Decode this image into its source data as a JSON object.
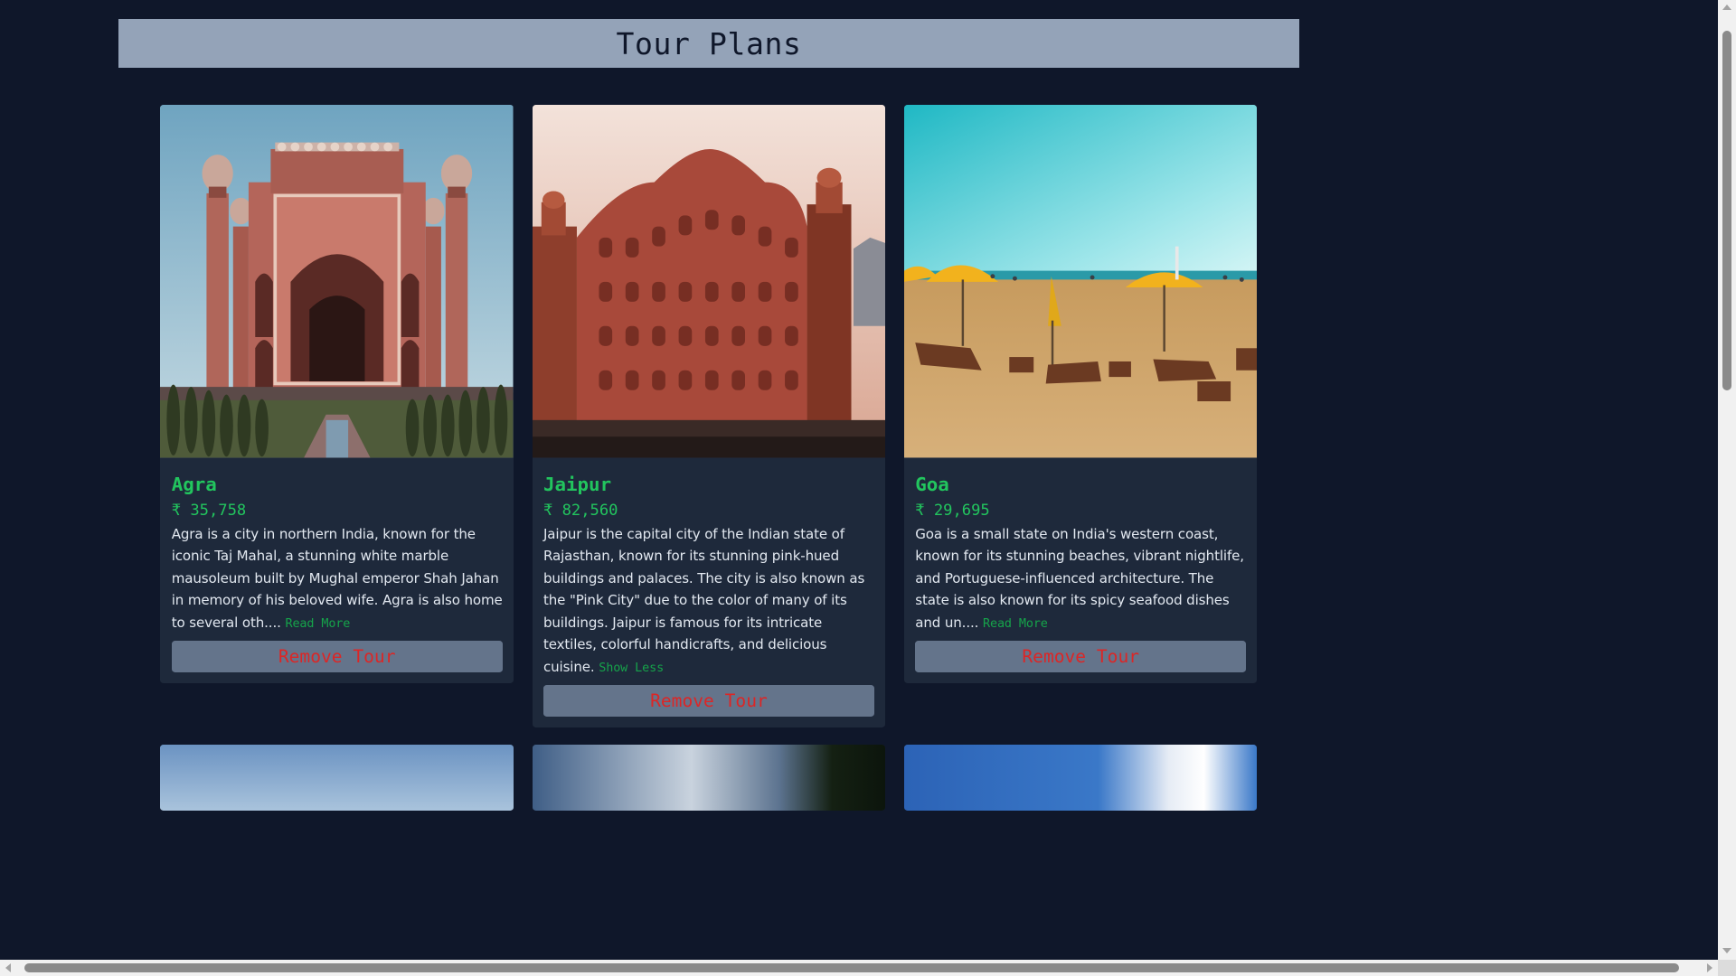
{
  "header": {
    "title": "Tour Plans"
  },
  "tours": [
    {
      "name": "Agra",
      "price": "₹ 35,758",
      "description": "Agra is a city in northern India, known for the iconic Taj Mahal, a stunning white marble mausoleum built by Mughal emperor Shah Jahan in memory of his beloved wife. Agra is also home to several oth....",
      "toggle_label": "Read More",
      "remove_label": "Remove Tour"
    },
    {
      "name": "Jaipur",
      "price": "₹ 82,560",
      "description": "Jaipur is the capital city of the Indian state of Rajasthan, known for its stunning pink-hued buildings and palaces. The city is also known as the \"Pink City\" due to the color of many of its buildings. Jaipur is famous for its intricate textiles, colorful handicrafts, and delicious cuisine.",
      "toggle_label": "Show Less",
      "remove_label": "Remove Tour"
    },
    {
      "name": "Goa",
      "price": "₹ 29,695",
      "description": "Goa is a small state on India's western coast, known for its stunning beaches, vibrant nightlife, and Portuguese-influenced architecture. The state is also known for its spicy seafood dishes and un....",
      "toggle_label": "Read More",
      "remove_label": "Remove Tour"
    }
  ],
  "colors": {
    "page_background": "#0f172a",
    "card_background": "#1e293b",
    "accent_green": "#22c55e",
    "remove_text": "#dc2626",
    "button_background": "#64748b",
    "title_bar": "#94a3b8"
  }
}
